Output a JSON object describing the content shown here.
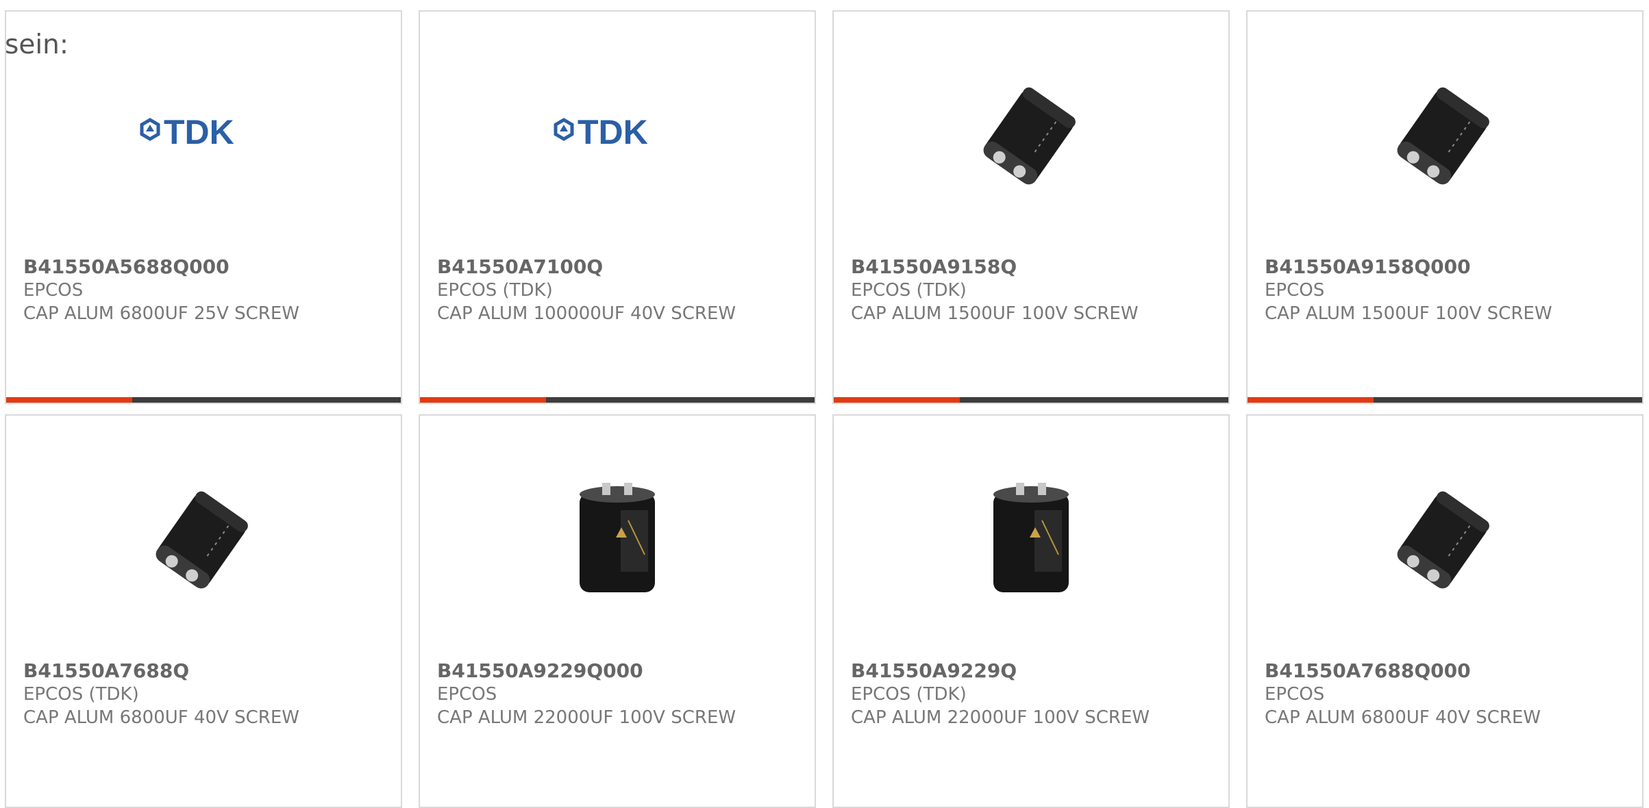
{
  "intro_text": "sein:",
  "accent_color": "#e23b12",
  "bar_track_color": "#3d3d3d",
  "products": [
    {
      "part": "B41550A5688Q000",
      "manufacturer": "EPCOS",
      "description": "CAP ALUM 6800UF 25V SCREW",
      "image": "tdk-logo",
      "logo_text": "TDK"
    },
    {
      "part": "B41550A7100Q",
      "manufacturer": "EPCOS (TDK)",
      "description": "CAP ALUM 100000UF 40V SCREW",
      "image": "tdk-logo",
      "logo_text": "TDK"
    },
    {
      "part": "B41550A9158Q",
      "manufacturer": "EPCOS (TDK)",
      "description": "CAP ALUM 1500UF 100V SCREW",
      "image": "capacitor-lying"
    },
    {
      "part": "B41550A9158Q000",
      "manufacturer": "EPCOS",
      "description": "CAP ALUM 1500UF 100V SCREW",
      "image": "capacitor-lying"
    },
    {
      "part": "B41550A7688Q",
      "manufacturer": "EPCOS (TDK)",
      "description": "CAP ALUM 6800UF 40V SCREW",
      "image": "capacitor-lying"
    },
    {
      "part": "B41550A9229Q000",
      "manufacturer": "EPCOS",
      "description": "CAP ALUM 22000UF 100V SCREW",
      "image": "capacitor-standing"
    },
    {
      "part": "B41550A9229Q",
      "manufacturer": "EPCOS (TDK)",
      "description": "CAP ALUM 22000UF 100V SCREW",
      "image": "capacitor-standing"
    },
    {
      "part": "B41550A7688Q000",
      "manufacturer": "EPCOS",
      "description": "CAP ALUM 6800UF 40V SCREW",
      "image": "capacitor-lying"
    }
  ]
}
